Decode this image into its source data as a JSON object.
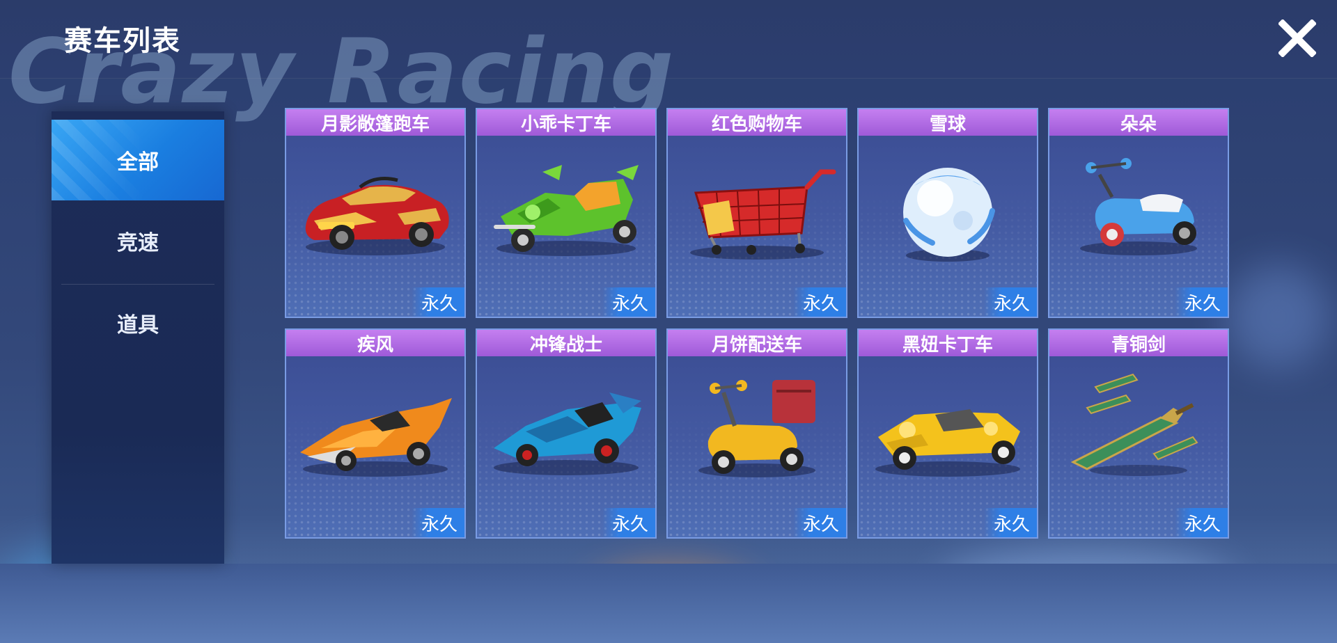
{
  "header": {
    "title": "赛车列表",
    "watermark": "Crazy Racing",
    "close_label": "close"
  },
  "sidebar": {
    "tabs": [
      {
        "label": "全部",
        "active": true
      },
      {
        "label": "竞速",
        "active": false
      },
      {
        "label": "道具",
        "active": false
      }
    ]
  },
  "cards": [
    {
      "name": "月影敞篷跑车",
      "duration": "永久",
      "icon": "red-gold-sports-car-icon"
    },
    {
      "name": "小乖卡丁车",
      "duration": "永久",
      "icon": "green-kart-icon"
    },
    {
      "name": "红色购物车",
      "duration": "永久",
      "icon": "shopping-cart-icon"
    },
    {
      "name": "雪球",
      "duration": "永久",
      "icon": "snowball-icon"
    },
    {
      "name": "朵朵",
      "duration": "永久",
      "icon": "blue-scooter-icon"
    },
    {
      "name": "疾风",
      "duration": "永久",
      "icon": "orange-racer-icon"
    },
    {
      "name": "冲锋战士",
      "duration": "永久",
      "icon": "blue-racer-icon"
    },
    {
      "name": "月饼配送车",
      "duration": "永久",
      "icon": "yellow-delivery-scooter-icon"
    },
    {
      "name": "黑妞卡丁车",
      "duration": "永久",
      "icon": "yellow-kart-icon"
    },
    {
      "name": "青铜剑",
      "duration": "永久",
      "icon": "bronze-sword-icon"
    }
  ],
  "colors": {
    "card_header": "#a65fdc",
    "badge": "#2e7fe6",
    "active_tab": "#1f86e6"
  }
}
